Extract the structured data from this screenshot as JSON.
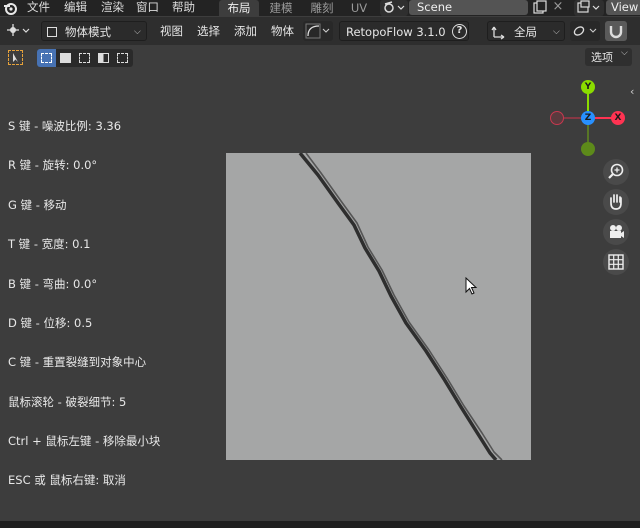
{
  "menu": {
    "items": [
      "文件",
      "编辑",
      "渲染",
      "窗口",
      "帮助"
    ]
  },
  "workspaces": [
    "布局",
    "建模",
    "雕刻",
    "UV"
  ],
  "scene": {
    "name": "Scene"
  },
  "view_layer": {
    "name": "View"
  },
  "header": {
    "mode_label": "物体模式",
    "view": "视图",
    "select": "选择",
    "add": "添加",
    "object": "物体",
    "addon_label": "RetopoFlow 3.1.0",
    "help_glyph": "?",
    "transform_orientation": "全局"
  },
  "options_label": "选项",
  "gizmo": {
    "y_label": "Y",
    "x_label": "X",
    "z_label": "Z"
  },
  "hints": [
    "S 键 - 噪波比例: 3.36",
    "R 键 - 旋转: 0.0°",
    "G 键 - 移动",
    "T 键 - 宽度: 0.1",
    "B 键 - 弯曲: 0.0°",
    "D 键 - 位移: 0.5",
    "C 键 - 重置裂缝到对象中心",
    "鼠标滚轮 - 破裂细节: 5",
    "Ctrl + 鼠标左键 - 移除最小块",
    "ESC 或 鼠标右键: 取消"
  ],
  "colors": {
    "accent": "#4772b3",
    "axis_x": "#ff3352",
    "axis_y": "#8bdc00",
    "axis_z": "#2890ff",
    "canvas": "#a5a6a6"
  },
  "icons": {
    "blender": "blender-logo-icon",
    "zoom": "zoom-icon",
    "pan": "hand-icon",
    "camera": "camera-icon",
    "grid": "grid-icon"
  }
}
